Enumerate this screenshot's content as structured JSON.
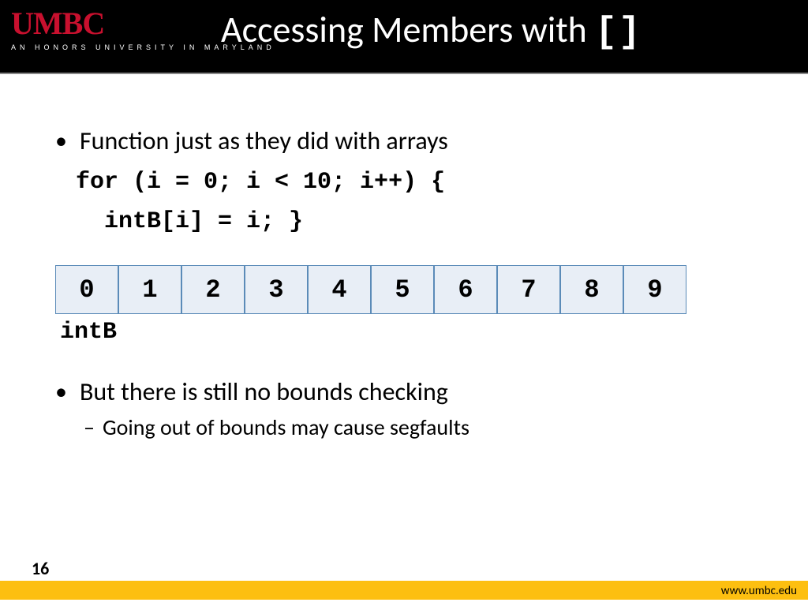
{
  "logo": {
    "main": "UMBC",
    "sub": "AN HONORS UNIVERSITY IN MARYLAND"
  },
  "title": {
    "text": "Accessing Members with ",
    "brackets": "[]"
  },
  "bullets": {
    "first": "Function just as they did with arrays",
    "code_line1": "for (i = 0; i < 10; i++) {",
    "code_line2": "  intB[i] = i; }",
    "array_label": "intB",
    "second": "But there is still no bounds checking",
    "sub": "Going out of bounds may cause segfaults"
  },
  "array_cells": [
    "0",
    "1",
    "2",
    "3",
    "4",
    "5",
    "6",
    "7",
    "8",
    "9"
  ],
  "page_number": "16",
  "footer_url": "www.umbc.edu"
}
